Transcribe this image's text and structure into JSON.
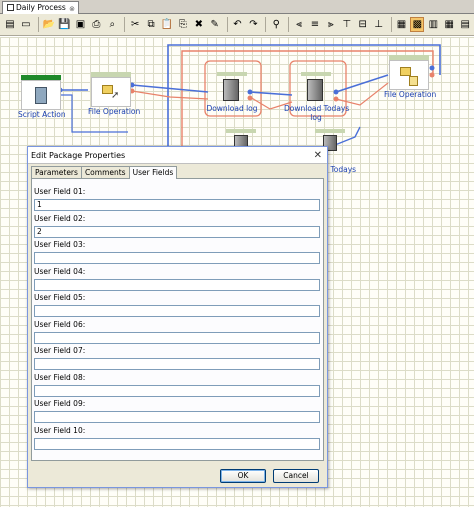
{
  "tab": {
    "title": "Daily Process"
  },
  "toolbar": {
    "buttons": [
      {
        "icon": "properties-icon",
        "glyph": "▤"
      },
      {
        "icon": "new-icon",
        "glyph": "▭"
      },
      {
        "icon": "open-folder-icon",
        "glyph": "📂"
      },
      {
        "icon": "save-icon",
        "glyph": "💾"
      },
      {
        "icon": "save-all-icon",
        "glyph": "▣"
      },
      {
        "icon": "print-icon",
        "glyph": "⎙"
      },
      {
        "icon": "print-preview-icon",
        "glyph": "⌕"
      },
      {
        "icon": "cut-icon",
        "glyph": "✂"
      },
      {
        "icon": "copy-icon",
        "glyph": "⧉"
      },
      {
        "icon": "paste-icon",
        "glyph": "📋"
      },
      {
        "icon": "paste-special-icon",
        "glyph": "⎘"
      },
      {
        "icon": "delete-icon",
        "glyph": "✖"
      },
      {
        "icon": "clear-icon",
        "glyph": "✎"
      },
      {
        "icon": "undo-icon",
        "glyph": "↶"
      },
      {
        "icon": "redo-icon",
        "glyph": "↷"
      },
      {
        "icon": "find-icon",
        "glyph": "⚲"
      },
      {
        "icon": "align-left-icon",
        "glyph": "⫷"
      },
      {
        "icon": "align-center-icon",
        "glyph": "≡"
      },
      {
        "icon": "align-right-icon",
        "glyph": "⫸"
      },
      {
        "icon": "align-top-icon",
        "glyph": "⊤"
      },
      {
        "icon": "align-middle-icon",
        "glyph": "⊟"
      },
      {
        "icon": "align-bottom-icon",
        "glyph": "⊥"
      },
      {
        "icon": "snap-to-grid-icon",
        "glyph": "▦"
      },
      {
        "icon": "show-grid-icon",
        "glyph": "▩"
      },
      {
        "icon": "schedule-icon",
        "glyph": "▥"
      },
      {
        "icon": "calendar-icon",
        "glyph": "▦"
      },
      {
        "icon": "calendar-week-icon",
        "glyph": "▤"
      }
    ],
    "accent": "#f5c56a"
  },
  "nodes": {
    "script_action": "Script Action",
    "file_operation_1": "File Operation",
    "download_log": "Download log",
    "download_todays_log_line1": "Download Todays",
    "download_todays_log_line2": "log",
    "download_todays_log_back": "l Todays",
    "file_operation_2": "File Operation"
  },
  "colors": {
    "wire_blue": "#4a6fd8",
    "wire_red": "#e8826a",
    "label_blue": "#1a3fb0"
  },
  "dialog": {
    "title": "Edit Package Properties",
    "tabs": [
      "Parameters",
      "Comments",
      "User Fields"
    ],
    "selected_tab": "User Fields",
    "fields": [
      {
        "label": "User Field 01:",
        "value": "1"
      },
      {
        "label": "User Field 02:",
        "value": "2"
      },
      {
        "label": "User Field 03:",
        "value": ""
      },
      {
        "label": "User Field 04:",
        "value": ""
      },
      {
        "label": "User Field 05:",
        "value": ""
      },
      {
        "label": "User Field 06:",
        "value": ""
      },
      {
        "label": "User Field 07:",
        "value": ""
      },
      {
        "label": "User Field 08:",
        "value": ""
      },
      {
        "label": "User Field 09:",
        "value": ""
      },
      {
        "label": "User Field 10:",
        "value": ""
      }
    ],
    "ok_label": "OK",
    "cancel_label": "Cancel"
  }
}
